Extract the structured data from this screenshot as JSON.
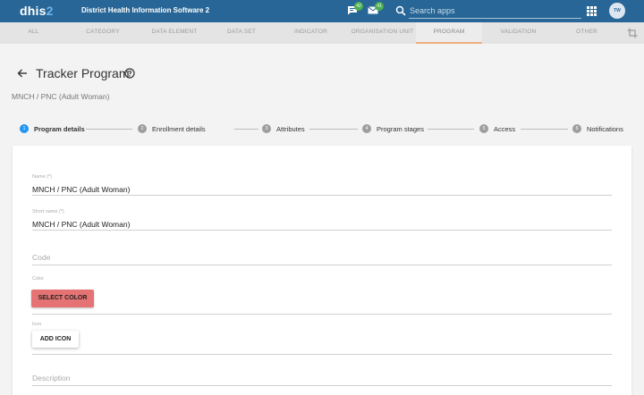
{
  "header": {
    "logo_text": "dhis",
    "logo_number": "2",
    "app_title": "District Health Information Software 2",
    "messages_badge": "42",
    "interpretations_badge": "41",
    "search_placeholder": "Search apps",
    "avatar_initials": "TW",
    "color": "#276696"
  },
  "tabs": [
    {
      "label": "ALL"
    },
    {
      "label": "CATEGORY"
    },
    {
      "label": "DATA ELEMENT"
    },
    {
      "label": "DATA SET"
    },
    {
      "label": "INDICATOR"
    },
    {
      "label": "ORGANISATION UNIT"
    },
    {
      "label": "PROGRAM"
    },
    {
      "label": "VALIDATION"
    },
    {
      "label": "OTHER"
    }
  ],
  "active_tab": "PROGRAM",
  "page": {
    "title": "Tracker Program",
    "subtitle": "MNCH / PNC (Adult Woman)"
  },
  "steps": [
    {
      "num": "1",
      "label": "Program details",
      "active": true
    },
    {
      "num": "2",
      "label": "Enrollment details"
    },
    {
      "num": "3",
      "label": "Attributes"
    },
    {
      "num": "4",
      "label": "Program stages"
    },
    {
      "num": "5",
      "label": "Access"
    },
    {
      "num": "6",
      "label": "Notifications"
    }
  ],
  "form": {
    "name_label": "Name (*)",
    "name_value": "MNCH / PNC (Adult Woman)",
    "short_name_label": "Short name (*)",
    "short_name_value": "MNCH / PNC (Adult Woman)",
    "code_placeholder": "Code",
    "color_label": "Color",
    "select_color_button": "SELECT COLOR",
    "select_color_bg": "#e57373",
    "icon_label": "Icon",
    "add_icon_button": "ADD ICON",
    "description_placeholder": "Description"
  }
}
